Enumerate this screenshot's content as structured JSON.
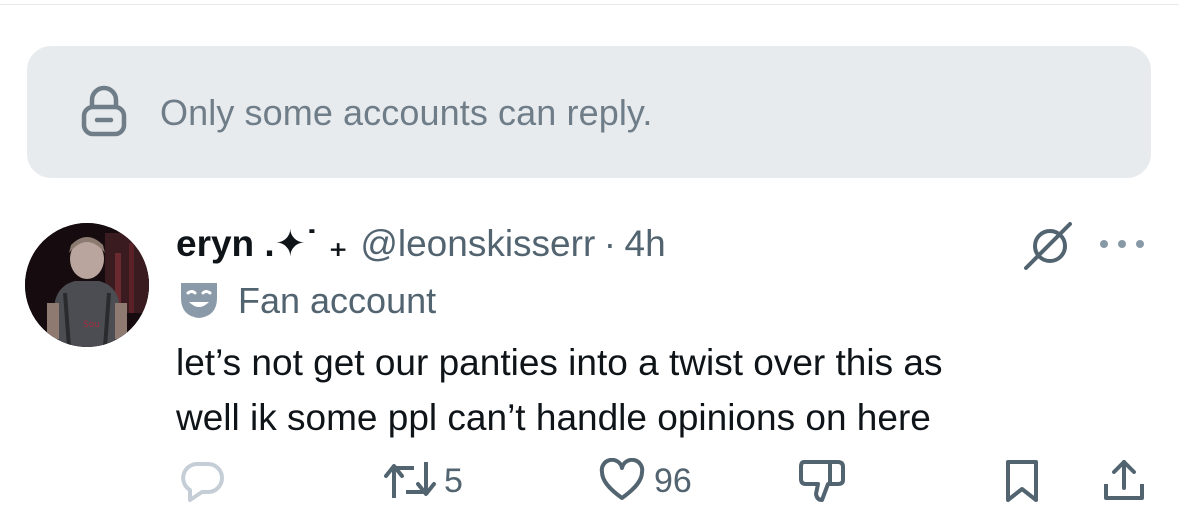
{
  "reply_restriction": {
    "icon": "lock-icon",
    "text": "Only some accounts can reply."
  },
  "tweet": {
    "author": {
      "display_name": "eryn .✦˙ ₊",
      "handle": "@leonskisserr",
      "separator": "·",
      "time": "4h"
    },
    "label": {
      "icon": "theater-mask-icon",
      "text": "Fan account"
    },
    "text_line1": "let’s not get our panties into a twist over this as",
    "text_line2": "well ik some ppl can’t handle opinions on here",
    "actions": {
      "reply_count": "",
      "retweet_count": "5",
      "like_count": "96"
    }
  },
  "colors": {
    "banner_bg": "#e8ebee",
    "secondary_text": "#536471",
    "primary_text": "#0f1419"
  }
}
